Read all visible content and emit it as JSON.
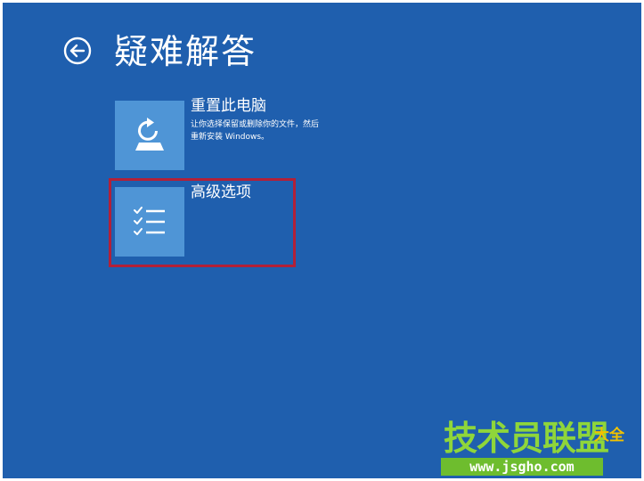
{
  "page": {
    "title": "疑难解答",
    "back_icon": "arrow-left-circle-icon",
    "background_color": "#1f5fae",
    "tile_color": "#4f95d6",
    "highlight_color": "#b22038"
  },
  "options": [
    {
      "label": "重置此电脑",
      "description_line1": "让你选择保留或删除你的文件，然后",
      "description_line2": "重新安装 Windows。",
      "icon": "reset-pc-icon"
    },
    {
      "label": "高级选项",
      "icon": "checklist-icon",
      "highlighted": true
    }
  ],
  "watermark": {
    "main_text": "技术员联盟",
    "suffix_text": "大全",
    "url": "www.jsgho.com",
    "main_color": "#8fd63a",
    "suffix_color": "#f2c200"
  }
}
